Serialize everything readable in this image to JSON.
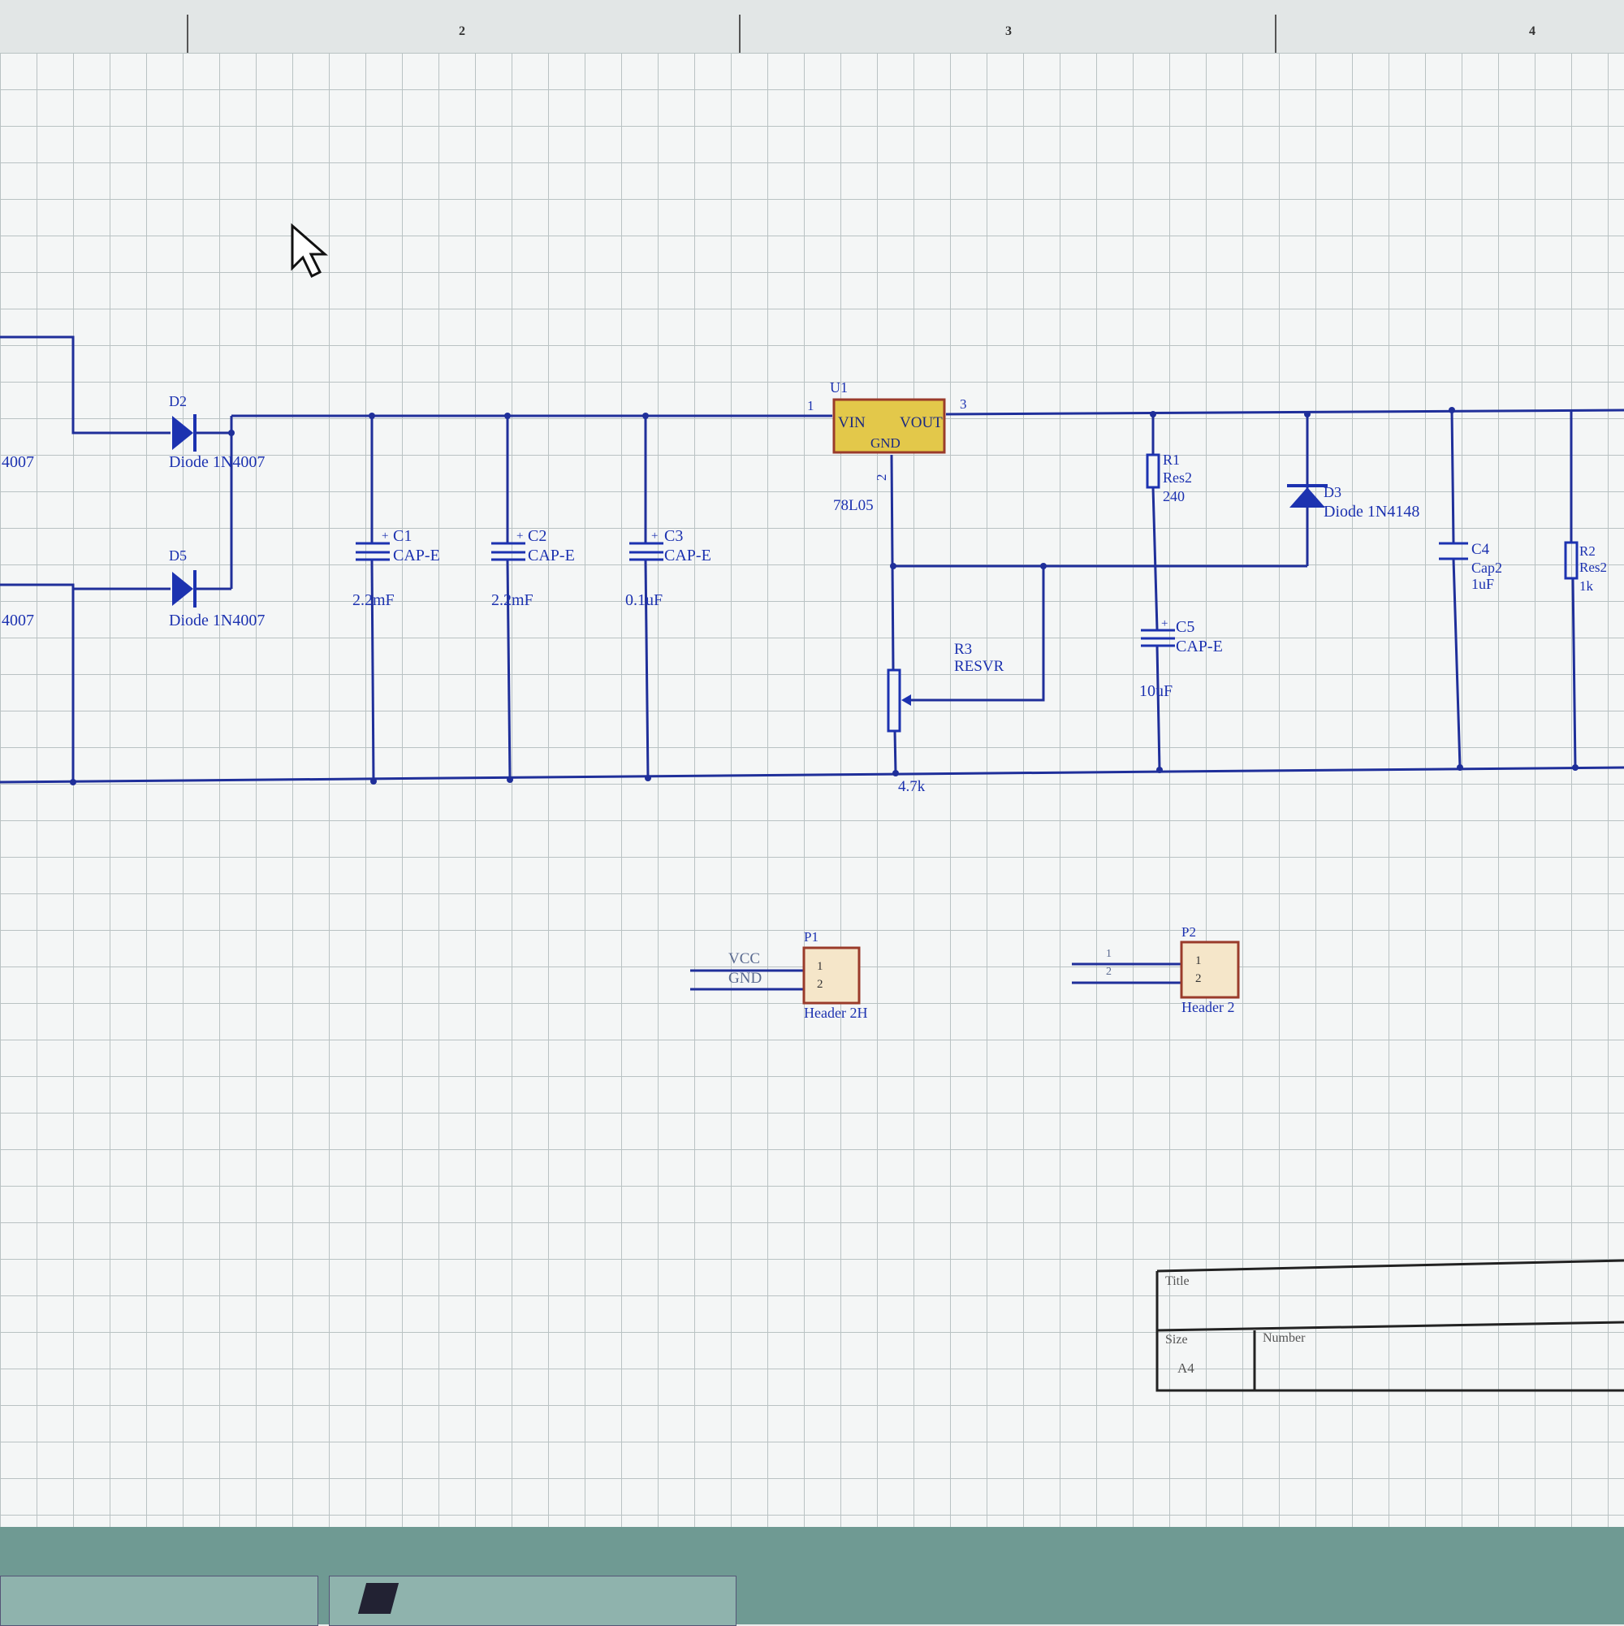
{
  "ruler": {
    "zones": [
      "2",
      "3",
      "4"
    ]
  },
  "components": {
    "d2": {
      "ref": "D2",
      "value": "Diode 1N4007"
    },
    "d5": {
      "ref": "D5",
      "value": "Diode 1N4007"
    },
    "left_labels": [
      "4007",
      "4007"
    ],
    "c1": {
      "ref": "C1",
      "type": "CAP-E",
      "value": "2.2mF"
    },
    "c2": {
      "ref": "C2",
      "type": "CAP-E",
      "value": "2.2mF"
    },
    "c3": {
      "ref": "C3",
      "type": "CAP-E",
      "value": "0.1uF"
    },
    "u1": {
      "ref": "U1",
      "part": "78L05",
      "vin": "VIN",
      "vout": "VOUT",
      "gnd": "GND",
      "pin1": "1",
      "pin2": "2",
      "pin3": "3"
    },
    "r1": {
      "ref": "R1",
      "type": "Res2",
      "value": "240"
    },
    "d3": {
      "ref": "D3",
      "value": "Diode 1N4148"
    },
    "r3": {
      "ref": "R3",
      "type": "RESVR",
      "value": "4.7k"
    },
    "c5": {
      "ref": "C5",
      "type": "CAP-E",
      "value": "10uF"
    },
    "c4": {
      "ref": "C4",
      "type": "Cap2",
      "value": "1uF"
    },
    "r2": {
      "ref": "R2",
      "type": "Res2",
      "value": "1k"
    },
    "p1": {
      "ref": "P1",
      "type": "Header 2H",
      "pin1": "1",
      "pin2": "2",
      "net1": "VCC",
      "net2": "GND"
    },
    "p2": {
      "ref": "P2",
      "type": "Header 2",
      "pin1": "1",
      "pin2": "2",
      "lead1": "1",
      "lead2": "2"
    }
  },
  "title_block": {
    "title_label": "Title",
    "size_label": "Size",
    "size_value": "A4",
    "number_label": "Number"
  },
  "colors": {
    "wire": "#1f2f9a",
    "component": "#1c32b0",
    "body_fill": "#f5e6c9",
    "body_stroke": "#9a3b2a",
    "regulator_fill": "#e3c84a",
    "grid": "#b9c2c3"
  }
}
